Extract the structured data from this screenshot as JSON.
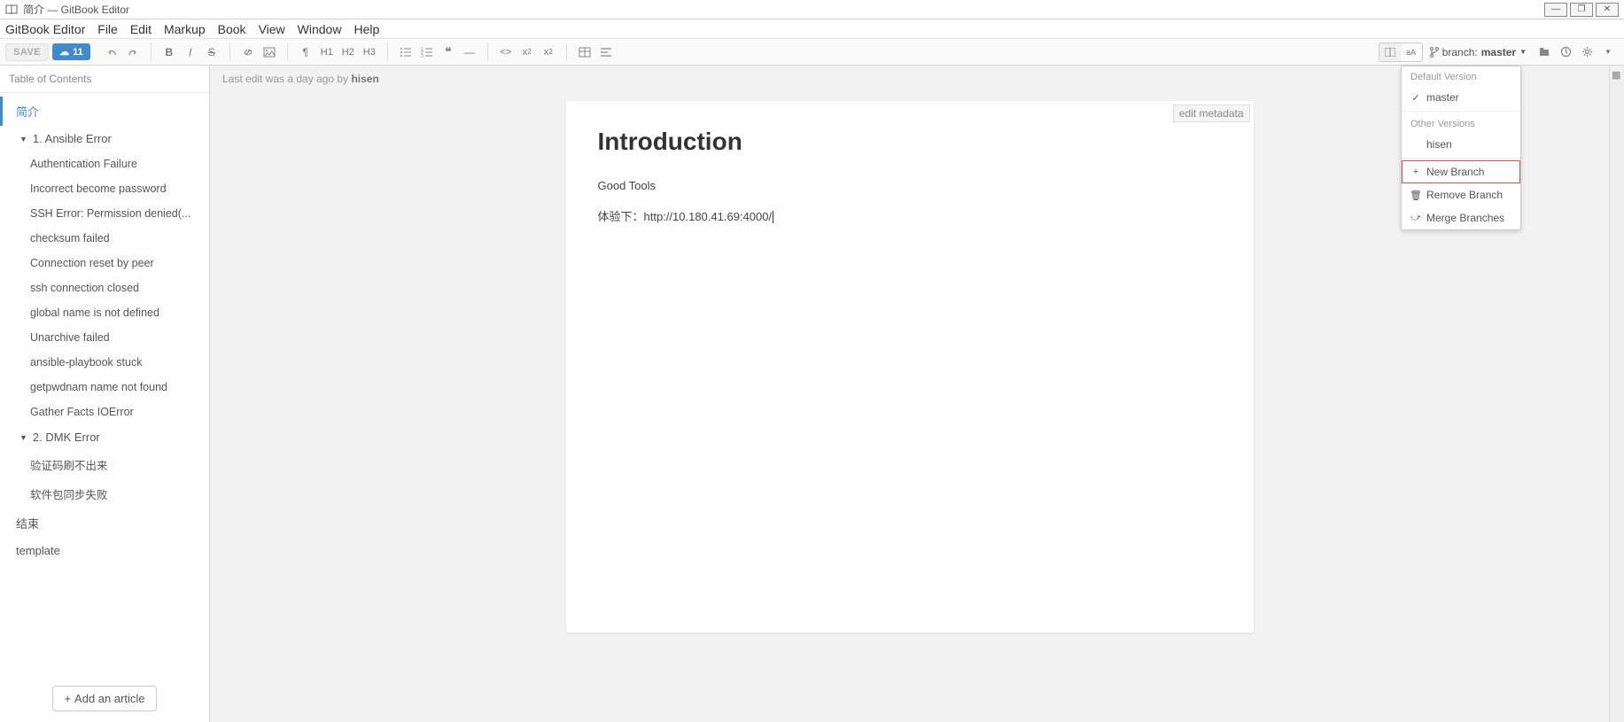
{
  "window": {
    "title": "简介 — GitBook Editor"
  },
  "menubar": {
    "app_name": "GitBook Editor",
    "items": [
      "File",
      "Edit",
      "Markup",
      "Book",
      "View",
      "Window",
      "Help"
    ]
  },
  "toolbar": {
    "save_label": "SAVE",
    "cloud_count": "11",
    "branch_prefix": "branch:",
    "branch_name": "master"
  },
  "sidebar": {
    "header": "Table of Contents",
    "add_article": "Add an article",
    "items": [
      {
        "label": "简介",
        "level": 0,
        "active": true
      },
      {
        "label": "1. Ansible Error",
        "level": 1,
        "expandable": true
      },
      {
        "label": "Authentication Failure",
        "level": 2
      },
      {
        "label": "Incorrect become password",
        "level": 2
      },
      {
        "label": "SSH Error: Permission denied(...",
        "level": 2
      },
      {
        "label": "checksum failed",
        "level": 2
      },
      {
        "label": "Connection reset by peer",
        "level": 2
      },
      {
        "label": "ssh connection closed",
        "level": 2
      },
      {
        "label": "global name is not defined",
        "level": 2
      },
      {
        "label": "Unarchive failed",
        "level": 2
      },
      {
        "label": "ansible-playbook stuck",
        "level": 2
      },
      {
        "label": "getpwdnam name not found",
        "level": 2
      },
      {
        "label": "Gather Facts IOError",
        "level": 2
      },
      {
        "label": "2. DMK Error",
        "level": 1,
        "expandable": true
      },
      {
        "label": "验证码刷不出来",
        "level": 2
      },
      {
        "label": "软件包同步失败",
        "level": 2
      },
      {
        "label": "结束",
        "level": 0
      },
      {
        "label": "template",
        "level": 0
      }
    ]
  },
  "content": {
    "status_prefix": "Last edit was a day ago by ",
    "status_author": "hisen",
    "edit_meta": "edit metadata",
    "heading": "Introduction",
    "body_line1": "Good Tools",
    "body_line2": "体验下：http://10.180.41.69:4000/"
  },
  "dropdown": {
    "section1_header": "Default Version",
    "default_version": "master",
    "section2_header": "Other Versions",
    "other_version": "hisen",
    "new_branch": "New Branch",
    "remove_branch": "Remove Branch",
    "merge_branches": "Merge Branches"
  }
}
